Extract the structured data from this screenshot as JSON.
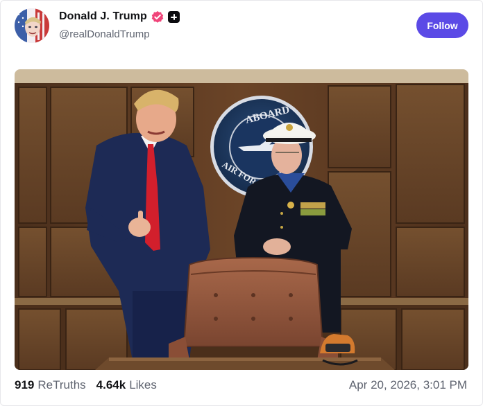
{
  "post": {
    "author": {
      "display_name": "Donald J. Trump",
      "handle": "@realDonaldTrump",
      "verified": true
    },
    "follow_label": "Follow",
    "media": {
      "seal_text_top": "ABOARD",
      "seal_text_bottom": "AIR FORCE"
    },
    "stats": {
      "retruths_count": "919",
      "retruths_label": "ReTruths",
      "likes_count": "4.64k",
      "likes_label": "Likes"
    },
    "timestamp": "Apr 20, 2026, 3:01 PM"
  },
  "colors": {
    "accent": "#5b4ae6",
    "verified": "#f0457a",
    "text_primary": "#101114",
    "text_secondary": "#5f6470"
  },
  "icons": {
    "verified": "verified-badge-icon",
    "plus": "plus-badge-icon"
  }
}
